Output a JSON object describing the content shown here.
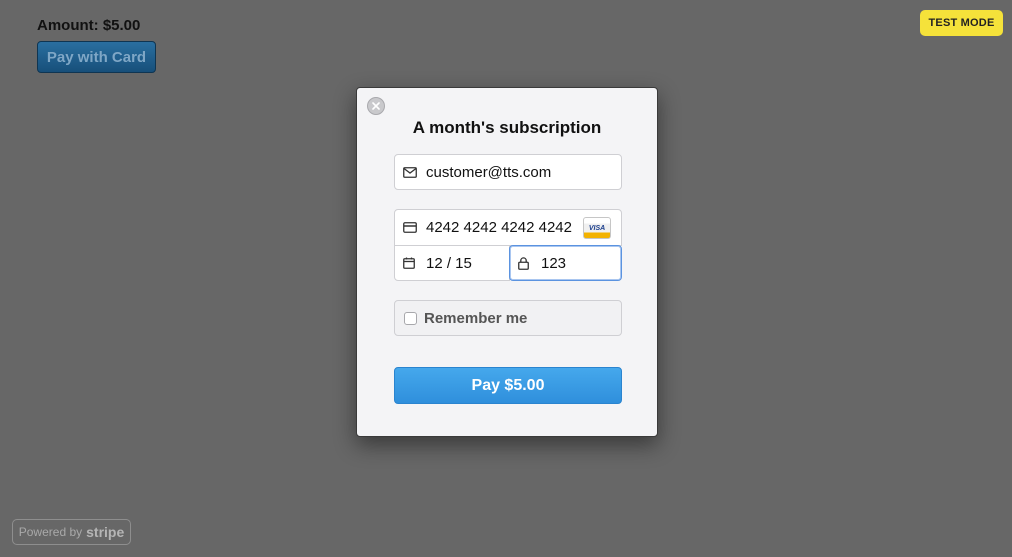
{
  "page": {
    "amount_text": "Amount: $5.00",
    "pay_with_card_label": "Pay with Card",
    "test_mode_label": "TEST MODE",
    "powered_by_prefix": "Powered by",
    "powered_by_brand": "stripe"
  },
  "modal": {
    "title": "A month's subscription",
    "email_value": "customer@tts.com",
    "card_number_value": "4242 4242 4242 4242",
    "card_brand": "VISA",
    "expiry_value": "12 / 15",
    "cvc_value": "123",
    "remember_label": "Remember me",
    "remember_checked": false,
    "pay_button_label": "Pay $5.00"
  },
  "icons": {
    "close": "close-icon",
    "email": "envelope-icon",
    "card": "credit-card-icon",
    "expiry": "calendar-icon",
    "cvc": "lock-icon"
  },
  "colors": {
    "backdrop": "#676767",
    "test_mode_bg": "#f5e23a",
    "pay_button": "#3a9be5",
    "focus_border": "#5b93e0"
  }
}
